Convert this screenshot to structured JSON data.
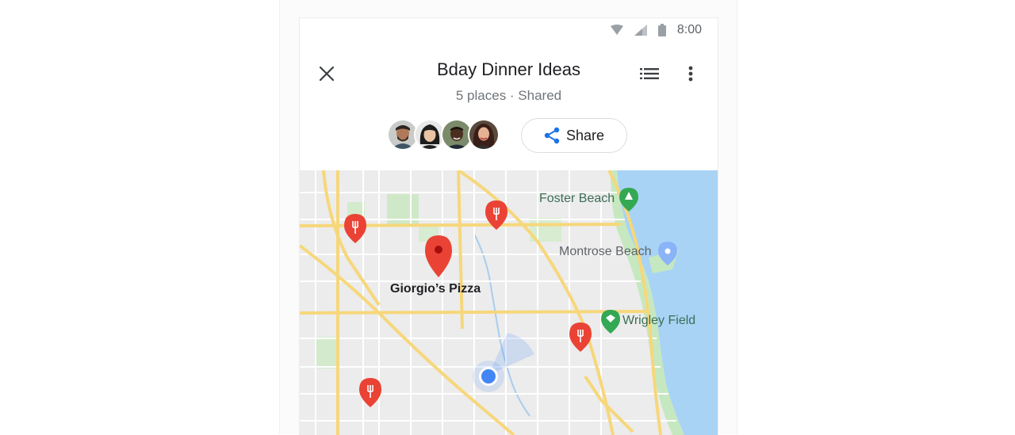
{
  "status_bar": {
    "time": "8:00"
  },
  "header": {
    "title": "Bday Dinner Ideas",
    "subtitle": "5 places · Shared",
    "share_label": "Share"
  },
  "map": {
    "labels": {
      "foster_beach": "Foster Beach",
      "montrose_beach": "Montrose Beach",
      "wrigley_field": "Wrigley Field",
      "selected_place": "Giorgio’s Pizza"
    }
  },
  "colors": {
    "pin_red": "#ea4335",
    "water": "#a8d3f5",
    "park_green": "#c6e8c0",
    "road_yellow": "#f6d77b",
    "location_blue": "#4285f4"
  },
  "icons": [
    "close-icon",
    "list-icon",
    "more-vert-icon",
    "share-icon",
    "restaurant-pin-icon",
    "park-icon",
    "place-icon",
    "location-dot-icon"
  ]
}
